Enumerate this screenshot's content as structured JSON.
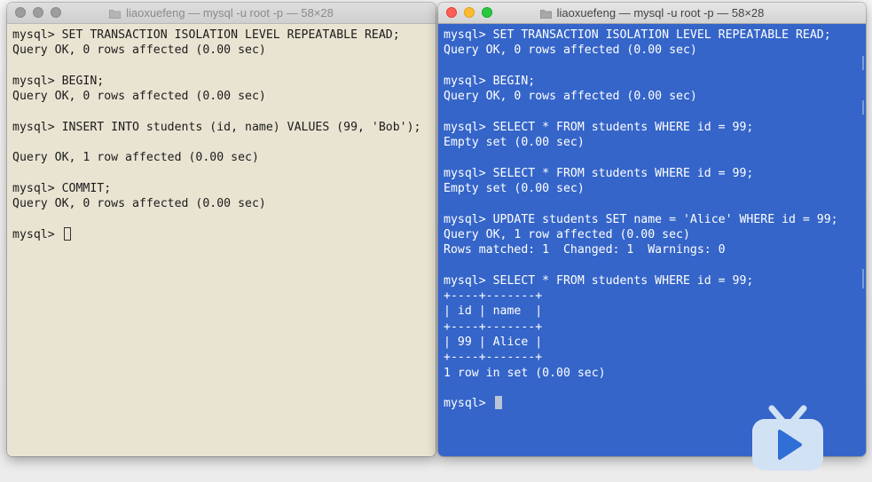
{
  "left_window": {
    "title": "liaoxuefeng — mysql -u root -p — 58×28",
    "lines": [
      "mysql> SET TRANSACTION ISOLATION LEVEL REPEATABLE READ;",
      "Query OK, 0 rows affected (0.00 sec)",
      "",
      "mysql> BEGIN;",
      "Query OK, 0 rows affected (0.00 sec)",
      "",
      "mysql> INSERT INTO students (id, name) VALUES (99, 'Bob');",
      "",
      "Query OK, 1 row affected (0.00 sec)",
      "",
      "mysql> COMMIT;",
      "Query OK, 0 rows affected (0.00 sec)",
      ""
    ],
    "prompt": "mysql> "
  },
  "right_window": {
    "title": "liaoxuefeng — mysql -u root -p — 58×28",
    "lines": [
      "mysql> SET TRANSACTION ISOLATION LEVEL REPEATABLE READ;",
      "Query OK, 0 rows affected (0.00 sec)",
      "",
      "mysql> BEGIN;",
      "Query OK, 0 rows affected (0.00 sec)",
      "",
      "mysql> SELECT * FROM students WHERE id = 99;",
      "Empty set (0.00 sec)",
      "",
      "mysql> SELECT * FROM students WHERE id = 99;",
      "Empty set (0.00 sec)",
      "",
      "mysql> UPDATE students SET name = 'Alice' WHERE id = 99;",
      "Query OK, 1 row affected (0.00 sec)",
      "Rows matched: 1  Changed: 1  Warnings: 0",
      "",
      "mysql> SELECT * FROM students WHERE id = 99;",
      "+----+-------+",
      "| id | name  |",
      "+----+-------+",
      "| 99 | Alice |",
      "+----+-------+",
      "1 row in set (0.00 sec)",
      ""
    ],
    "prompt": "mysql> "
  },
  "colors": {
    "left_terminal_bg": "#e9e4d2",
    "right_terminal_bg": "#3565c9",
    "logo": "#d2e2f5"
  },
  "icons": {
    "folder": "folder-icon",
    "logo": "video-site-logo"
  }
}
